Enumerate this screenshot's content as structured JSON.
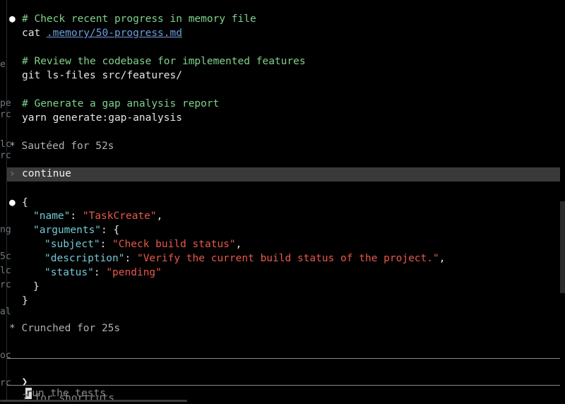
{
  "block1": {
    "comment1": "# Check recent progress in memory file",
    "cmd1_prefix": "cat ",
    "cmd1_link": ".memory/50-progress.md",
    "comment2": "# Review the codebase for implemented features",
    "cmd2": "git ls-files src/features/",
    "comment3": "# Generate a gap analysis report",
    "cmd3": "yarn generate:gap-analysis"
  },
  "status1": "* Sautéed for 52s",
  "user_prompt": {
    "glyph": "›",
    "text": "continue"
  },
  "json_block": {
    "open_brace": "{",
    "name_key": "\"name\"",
    "name_value": "\"TaskCreate\"",
    "args_key": "\"arguments\"",
    "subject_key": "\"subject\"",
    "subject_value": "\"Check build status\"",
    "description_key": "\"description\"",
    "description_value": "\"Verify the current build status of the project.\"",
    "status_key": "\"status\"",
    "status_value": "\"pending\""
  },
  "status2": "* Crunched for 25s",
  "input": {
    "prompt_glyph": "❯",
    "cursor_char": "r",
    "rest": "un the tests"
  },
  "footer_hint": "? for shortcuts",
  "left_fragments": [
    "e",
    "pe",
    "rc",
    "lc",
    "rc",
    "ng",
    "5c",
    "lc",
    "rc",
    "al",
    "oc",
    "rc"
  ]
}
